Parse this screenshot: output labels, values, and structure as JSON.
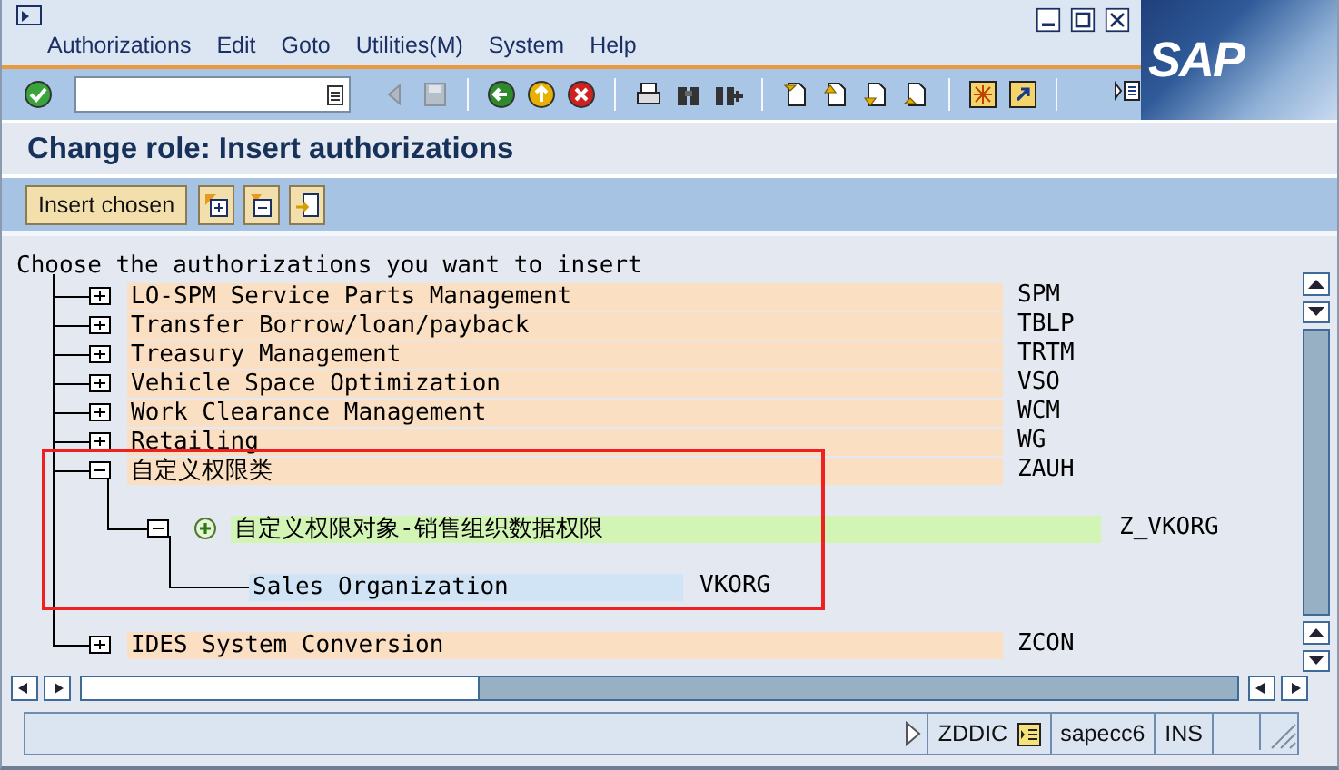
{
  "window": {
    "title": "Change role: Insert authorizations"
  },
  "menu": [
    {
      "label": "Authorizations"
    },
    {
      "label": "Edit"
    },
    {
      "label": "Goto"
    },
    {
      "label": "Utilities(M)"
    },
    {
      "label": "System"
    },
    {
      "label": "Help"
    }
  ],
  "logo": "SAP",
  "app_toolbar": {
    "button": "Insert chosen"
  },
  "tree": {
    "heading": "Choose the authorizations you want to insert",
    "nodes": [
      {
        "kind": "category",
        "label": "LO-SPM Service Parts Management",
        "code": "SPM",
        "expanded": false
      },
      {
        "kind": "category",
        "label": "Transfer Borrow/loan/payback",
        "code": "TBLP",
        "expanded": false
      },
      {
        "kind": "category",
        "label": "Treasury Management",
        "code": "TRTM",
        "expanded": false
      },
      {
        "kind": "category",
        "label": "Vehicle Space Optimization",
        "code": "VSO",
        "expanded": false
      },
      {
        "kind": "category",
        "label": "Work Clearance Management",
        "code": "WCM",
        "expanded": false
      },
      {
        "kind": "category",
        "label": "Retailing",
        "code": "WG",
        "expanded": false
      },
      {
        "kind": "category",
        "label": "自定义权限类",
        "code": "ZAUH",
        "expanded": true,
        "children": [
          {
            "kind": "object",
            "label": "自定义权限对象-销售组织数据权限",
            "code": "Z_VKORG",
            "expanded": true,
            "children": [
              {
                "kind": "field",
                "label": "Sales Organization",
                "code": "VKORG"
              }
            ]
          }
        ]
      },
      {
        "kind": "category",
        "label": "IDES System Conversion",
        "code": "ZCON",
        "expanded": false
      }
    ]
  },
  "status_bar": {
    "user": "ZDDIC",
    "system": "sapecc6",
    "mode": "INS"
  }
}
